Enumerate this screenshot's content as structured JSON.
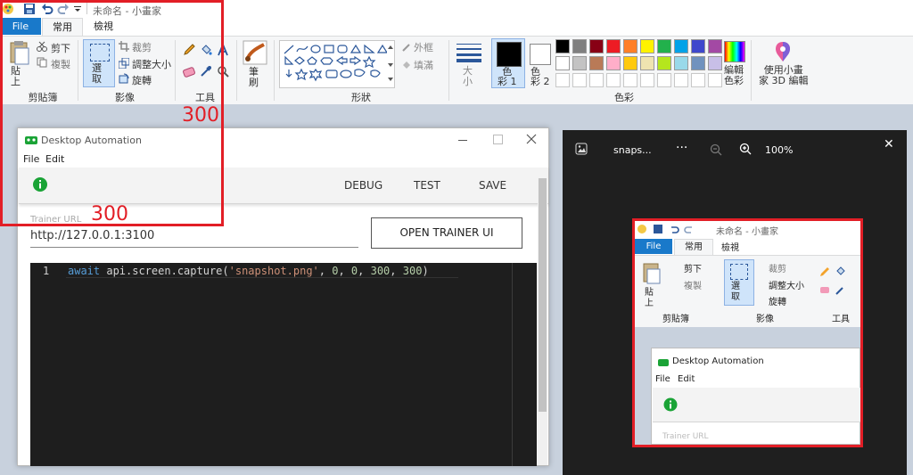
{
  "paint": {
    "title": "未命名 - 小畫家",
    "tabs": [
      "File",
      "常用",
      "檢視"
    ],
    "clipboard": {
      "paste": "貼\n上",
      "cut": "剪下",
      "copy": "複製",
      "group": "剪貼簿"
    },
    "image": {
      "select": "選\n取",
      "crop": "裁剪",
      "resize": "調整大小",
      "rotate": "旋轉",
      "group": "影像"
    },
    "tools_group": "工具",
    "brushes": "筆\n刷",
    "shapes": {
      "outline": "外框",
      "fill": "填滿",
      "group": "形狀"
    },
    "size": "大\n小",
    "color1": "色\n彩 1",
    "color2": "色\n彩 2",
    "colors_group": "色彩",
    "edit_colors": "編輯\n色彩",
    "paint3d": "使用小畫\n家 3D 編輯",
    "palette_row1": [
      "#000000",
      "#7f7f7f",
      "#880015",
      "#ed1c24",
      "#ff7f27",
      "#fff200",
      "#22b14c",
      "#00a2e8",
      "#3f48cc",
      "#a349a4"
    ],
    "palette_row2": [
      "#ffffff",
      "#c3c3c3",
      "#b97a57",
      "#ffaec9",
      "#ffc90e",
      "#efe4b0",
      "#b5e61d",
      "#99d9ea",
      "#7092be",
      "#c8bfe7"
    ],
    "accent": "#2b579a"
  },
  "annotation": {
    "label_w": "300",
    "label_h": "300",
    "color": "#e21e26"
  },
  "automation": {
    "title": "Desktop Automation",
    "menu": [
      "File",
      "Edit"
    ],
    "toolbar": {
      "debug": "DEBUG",
      "test": "TEST",
      "save": "SAVE"
    },
    "trainer_label": "Trainer URL",
    "trainer_url": "http://127.0.0.1:3100",
    "open_trainer": "OPEN TRAINER UI",
    "code": {
      "line_no": "1",
      "await": "await",
      "call": " api.screen.capture(",
      "str": "'snapshot.png'",
      "args": ", ",
      "n0": "0",
      "c1": ", ",
      "n1": "0",
      "c2": ", ",
      "n2": "300",
      "c3": ", ",
      "n3": "300",
      "close": ")"
    },
    "status_color": "#1aa336"
  },
  "viewer": {
    "title": "snaps...",
    "more": "···",
    "zoom": "100%",
    "close": "✕",
    "preview": {
      "title": "未命名 - 小畫家",
      "tabs": [
        "File",
        "常用",
        "檢視"
      ],
      "cut": "剪下",
      "copy": "複製",
      "crop": "裁剪",
      "resize": "調整大小",
      "rotate": "旋轉",
      "paste": "貼\n上",
      "select": "選\n取",
      "group_clip": "剪貼簿",
      "group_img": "影像",
      "group_tools": "工具",
      "app_title": "Desktop Automation",
      "menu": [
        "File",
        "Edit"
      ],
      "trainer_label": "Trainer URL"
    }
  }
}
